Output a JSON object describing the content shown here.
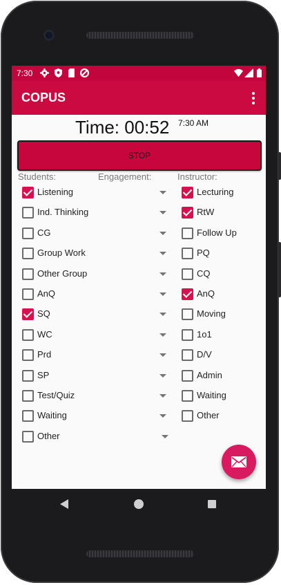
{
  "status": {
    "time": "7:30"
  },
  "app": {
    "title": "COPUS"
  },
  "timer": {
    "label": "Time: 00:52",
    "clock": "7:30 AM"
  },
  "stop_label": "STOP",
  "headers": {
    "students": "Students:",
    "engagement": "Engagement:",
    "instructor": "Instructor:"
  },
  "students": [
    {
      "label": "Listening",
      "checked": true
    },
    {
      "label": "Ind. Thinking",
      "checked": false
    },
    {
      "label": "CG",
      "checked": false
    },
    {
      "label": "Group Work",
      "checked": false
    },
    {
      "label": "Other Group",
      "checked": false
    },
    {
      "label": "AnQ",
      "checked": false
    },
    {
      "label": "SQ",
      "checked": true
    },
    {
      "label": "WC",
      "checked": false
    },
    {
      "label": "Prd",
      "checked": false
    },
    {
      "label": "SP",
      "checked": false
    },
    {
      "label": "Test/Quiz",
      "checked": false
    },
    {
      "label": "Waiting",
      "checked": false
    },
    {
      "label": "Other",
      "checked": false
    }
  ],
  "instructor": [
    {
      "label": "Lecturing",
      "checked": true
    },
    {
      "label": "RtW",
      "checked": true
    },
    {
      "label": "Follow Up",
      "checked": false
    },
    {
      "label": "PQ",
      "checked": false
    },
    {
      "label": "CQ",
      "checked": false
    },
    {
      "label": "AnQ",
      "checked": true
    },
    {
      "label": "Moving",
      "checked": false
    },
    {
      "label": "1o1",
      "checked": false
    },
    {
      "label": "D/V",
      "checked": false
    },
    {
      "label": "Admin",
      "checked": false
    },
    {
      "label": "Waiting",
      "checked": false
    },
    {
      "label": "Other",
      "checked": false
    }
  ],
  "icons": {
    "fab": "email-icon",
    "status": [
      "settings-icon",
      "shield-icon",
      "sd-card-icon",
      "data-saver-icon",
      "wifi-icon",
      "signal-icon",
      "battery-icon"
    ],
    "nav": [
      "back-icon",
      "home-icon",
      "recents-icon"
    ]
  },
  "colors": {
    "accent": "#cc0a42",
    "fab": "#d81b60",
    "checkbox": "#d6114f"
  }
}
